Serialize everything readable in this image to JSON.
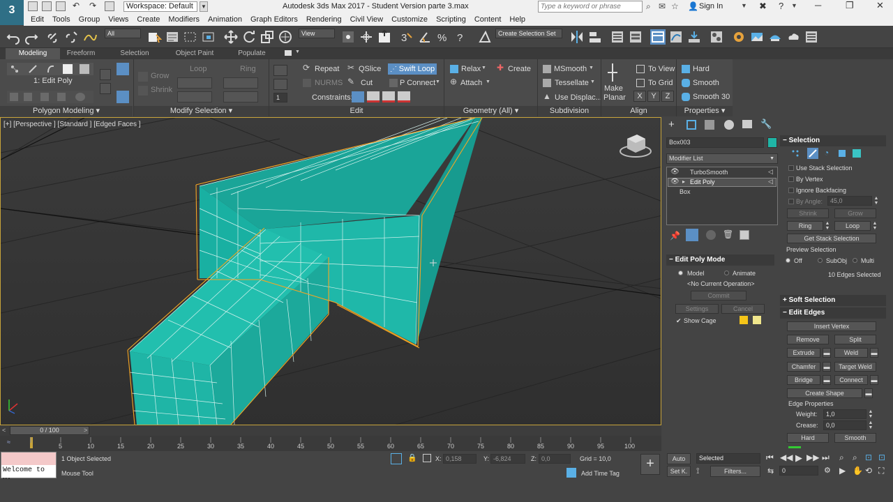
{
  "window": {
    "title": "Autodesk 3ds Max 2017 - Student Version   parte 3.max",
    "logo": "3",
    "workspace": "Workspace: Default",
    "search_placeholder": "Type a keyword or phrase",
    "sign_in": "Sign In"
  },
  "menu": [
    "Edit",
    "Tools",
    "Group",
    "Views",
    "Create",
    "Modifiers",
    "Animation",
    "Graph Editors",
    "Rendering",
    "Civil View",
    "Customize",
    "Scripting",
    "Content",
    "Help"
  ],
  "main_toolbar": {
    "selection_filter": "All",
    "ref_coord": "View",
    "named_selection": "Create Selection Set"
  },
  "ribbon": {
    "tabs": [
      "Modeling",
      "Freeform",
      "Selection",
      "Object Paint",
      "Populate"
    ],
    "active_tab": "Modeling",
    "modifier_label": "1: Edit Poly",
    "groups": [
      "Polygon Modeling",
      "Modify Selection",
      "Edit",
      "Geometry (All)",
      "Subdivision",
      "Align",
      "Properties"
    ],
    "modify_selection": {
      "grow": "Grow",
      "shrink": "Shrink",
      "loop": "Loop",
      "ring": "Ring"
    },
    "edit": {
      "repeat": "Repeat",
      "qslice": "QSlice",
      "swift_loop": "Swift Loop",
      "nurms": "NURMS",
      "cut": "Cut",
      "p_connect": "P Connect",
      "constraints": "Constraints:"
    },
    "geometry": {
      "relax": "Relax",
      "create": "Create",
      "attach": "Attach"
    },
    "subdivision": {
      "msmooth": "MSmooth",
      "tessellate": "Tessellate",
      "use_displac": "Use Displac..."
    },
    "align": {
      "make_planar_1": "Make",
      "make_planar_2": "Planar",
      "to_view": "To View",
      "to_grid": "To Grid",
      "x": "X",
      "y": "Y",
      "z": "Z"
    },
    "properties": {
      "hard": "Hard",
      "smooth": "Smooth",
      "smooth30": "Smooth 30"
    }
  },
  "viewport": {
    "label": "[+] [Perspective ] [Standard ] [Edged Faces ]"
  },
  "timeline": {
    "frame": "0 / 100",
    "ticks": [
      "5",
      "10",
      "15",
      "20",
      "25",
      "30",
      "35",
      "40",
      "45",
      "50",
      "55",
      "60",
      "65",
      "70",
      "75",
      "80",
      "85",
      "90",
      "95",
      "100"
    ]
  },
  "status": {
    "maxscript_text": "Welcome to MA",
    "objects_selected": "1 Object Selected",
    "prompt": "Mouse Tool",
    "x_label": "X:",
    "x_value": "0,158",
    "y_label": "Y:",
    "y_value": "-6,824",
    "z_label": "Z:",
    "z_value": "0,0",
    "grid": "Grid = 10,0",
    "add_time_tag": "Add Time Tag",
    "auto": "Auto",
    "set_key": "Set K.",
    "selected": "Selected",
    "filters": "Filters...",
    "frame_field": "0"
  },
  "command_panel": {
    "object_name": "Box003",
    "object_color": "#1fb5a6",
    "modifier_list": "Modifier List",
    "stack": [
      "TurboSmooth",
      "Edit Poly",
      "Box"
    ],
    "edit_poly_mode": {
      "title": "Edit Poly Mode",
      "model": "Model",
      "animate": "Animate",
      "no_op": "<No Current Operation>",
      "commit": "Commit",
      "settings": "Settings",
      "cancel": "Cancel",
      "show_cage": "Show Cage",
      "cage_color_1": "#f5c518",
      "cage_color_2": "#f0e68c"
    },
    "selection": {
      "title": "Selection",
      "use_stack": "Use Stack Selection",
      "by_vertex": "By Vertex",
      "ignore_backfacing": "Ignore Backfacing",
      "by_angle": "By Angle:",
      "by_angle_value": "45,0",
      "shrink": "Shrink",
      "grow": "Grow",
      "ring": "Ring",
      "loop": "Loop",
      "get_stack": "Get Stack Selection",
      "preview": "Preview Selection",
      "off": "Off",
      "subobj": "SubObj",
      "multi": "Multi",
      "edges_selected": "10 Edges Selected"
    },
    "soft_selection": "Soft Selection",
    "edit_edges": {
      "title": "Edit Edges",
      "insert_vertex": "Insert Vertex",
      "remove": "Remove",
      "split": "Split",
      "extrude": "Extrude",
      "weld": "Weld",
      "chamfer": "Chamfer",
      "target_weld": "Target Weld",
      "bridge": "Bridge",
      "connect": "Connect",
      "create_shape": "Create Shape",
      "edge_properties": "Edge Properties",
      "weight": "Weight:",
      "weight_value": "1,0",
      "crease": "Crease:",
      "crease_value": "0,0",
      "hard": "Hard",
      "smooth": "Smooth"
    }
  },
  "colors": {
    "mesh": "#1fb5a6",
    "selection_highlight": "#5b8fc4",
    "cage": "#f5a623"
  }
}
